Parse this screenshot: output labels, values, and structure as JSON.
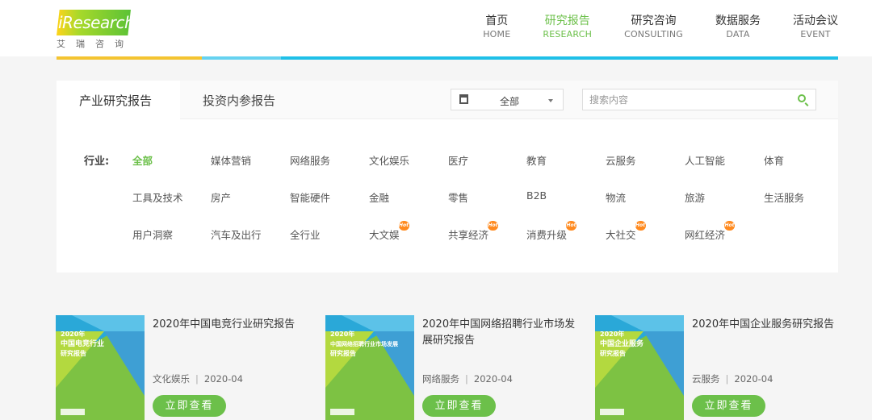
{
  "logo": {
    "text": "iResearch",
    "cn": "艾瑞咨询"
  },
  "nav": [
    {
      "cn": "首页",
      "en": "HOME",
      "active": false
    },
    {
      "cn": "研究报告",
      "en": "RESEARCH",
      "active": true
    },
    {
      "cn": "研究咨询",
      "en": "CONSULTING",
      "active": false
    },
    {
      "cn": "数据服务",
      "en": "DATA",
      "active": false
    },
    {
      "cn": "活动会议",
      "en": "EVENT",
      "active": false
    }
  ],
  "tabs": {
    "active": "产业研究报告",
    "other": "投资内参报告"
  },
  "filter": {
    "year_value": "全部",
    "search_placeholder": "搜索内容"
  },
  "industry": {
    "label": "行业:",
    "rows": [
      [
        "全部",
        "媒体营销",
        "网络服务",
        "文化娱乐",
        "医疗",
        "教育",
        "云服务",
        "人工智能",
        "体育"
      ],
      [
        "工具及技术",
        "房产",
        "智能硬件",
        "金融",
        "零售",
        "B2B",
        "物流",
        "旅游",
        "生活服务"
      ],
      [
        "用户洞察",
        "汽车及出行",
        "全行业",
        "大文娱",
        "共享经济",
        "消费升级",
        "大社交",
        "网红经济"
      ]
    ],
    "selected": "全部",
    "hot_badge": "Hot",
    "hot_items": [
      "大文娱",
      "共享经济",
      "消费升级",
      "大社交",
      "网红经济"
    ]
  },
  "reports": [
    {
      "title": "2020年中国电竞行业研究报告",
      "cover_year": "2020年",
      "cover_title": "中国电竞行业",
      "cover_sub": "研究报告",
      "category": "文化娱乐",
      "date": "2020-04",
      "button": "立即查看"
    },
    {
      "title": "2020年中国网络招聘行业市场发展研究报告",
      "cover_year": "2020年",
      "cover_title": "中国网络招聘行业市场发展",
      "cover_sub": "研究报告",
      "category": "网络服务",
      "date": "2020-04",
      "button": "立即查看"
    },
    {
      "title": "2020年中国企业服务研究报告",
      "cover_year": "2020年",
      "cover_title": "中国企业服务",
      "cover_sub": "研究报告",
      "category": "云服务",
      "date": "2020-04",
      "button": "立即查看"
    }
  ]
}
